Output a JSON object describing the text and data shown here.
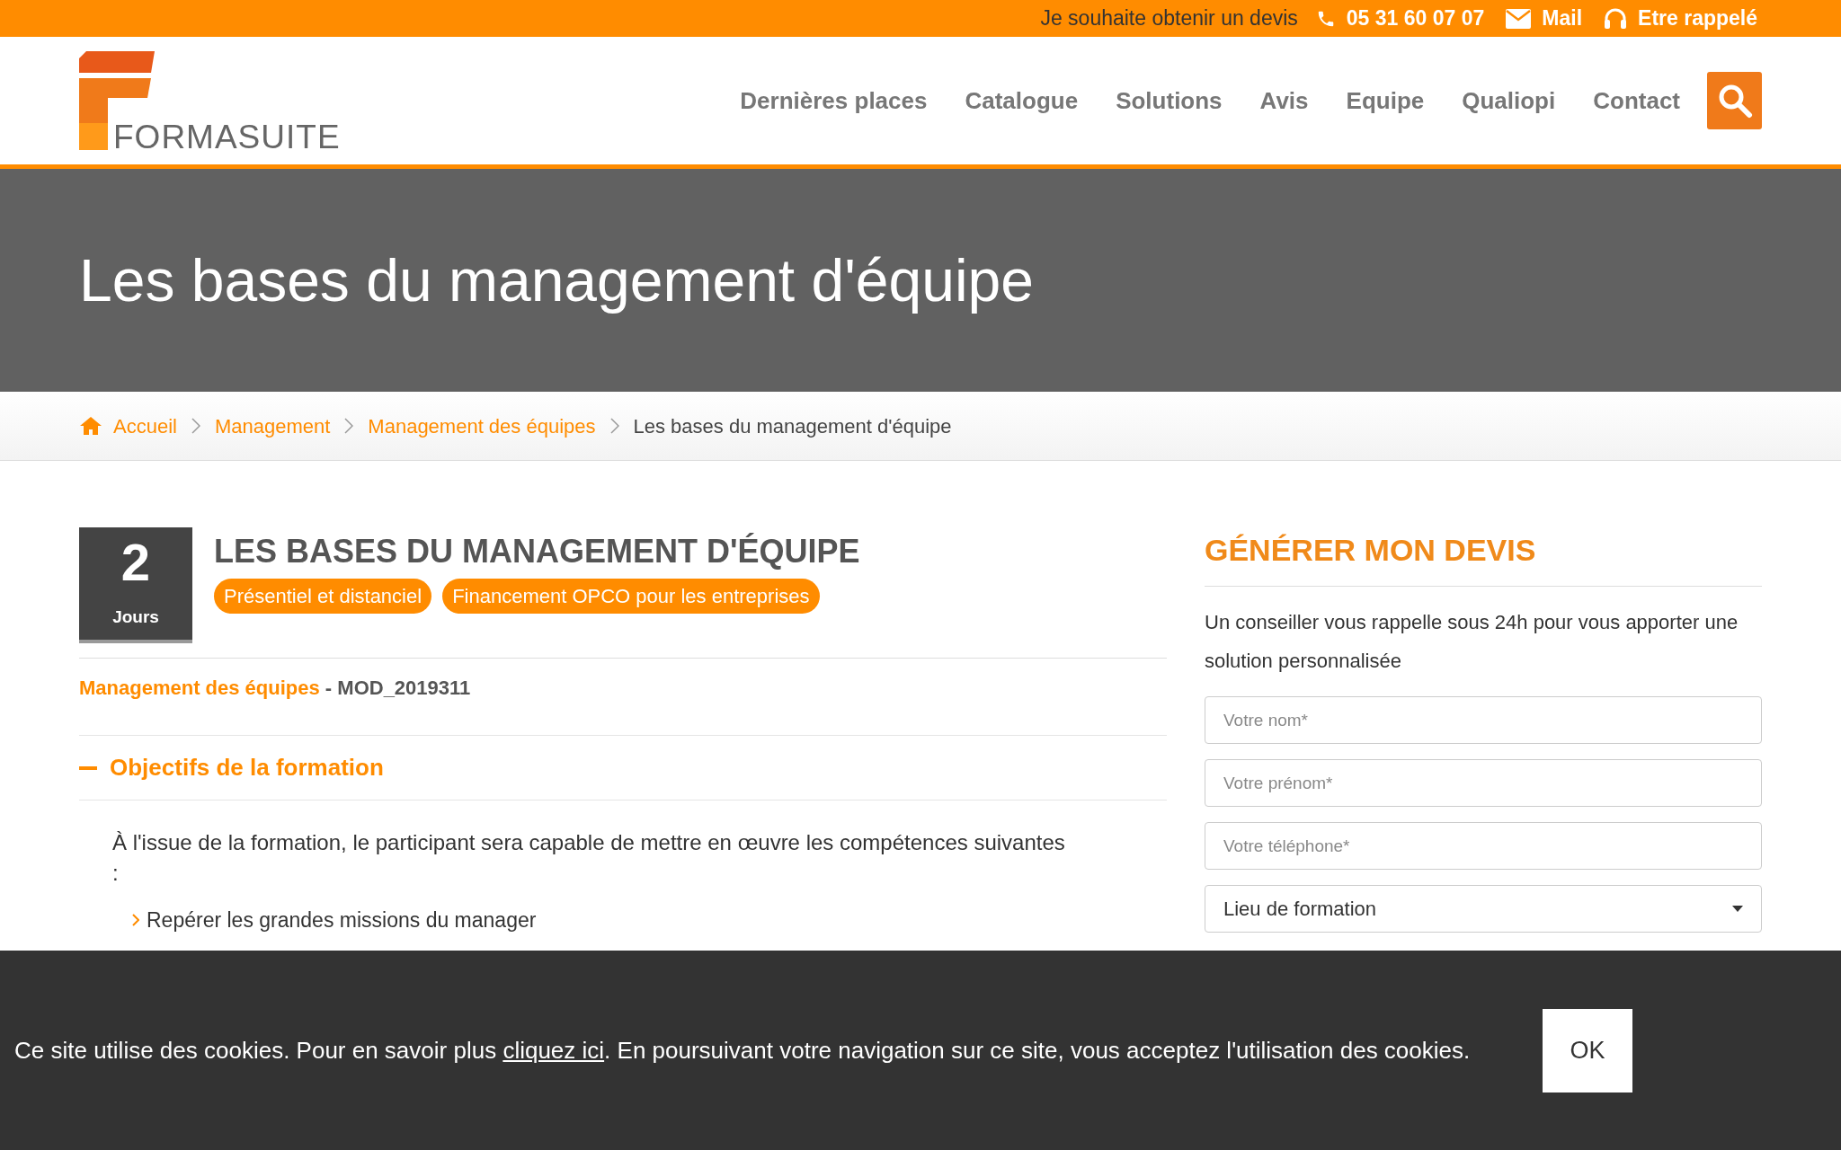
{
  "top_bar": {
    "quote_prompt": "Je souhaite obtenir un devis",
    "phone": "05 31 60 07 07",
    "mail": "Mail",
    "callback": "Etre rappelé"
  },
  "logo": {
    "text": "FORMASUITE"
  },
  "nav": {
    "items": [
      "Dernières places",
      "Catalogue",
      "Solutions",
      "Avis",
      "Equipe",
      "Qualiopi",
      "Contact"
    ]
  },
  "hero": {
    "title": "Les bases du management d'équipe"
  },
  "breadcrumb": [
    {
      "label": "Accueil",
      "current": false
    },
    {
      "label": "Management",
      "current": false
    },
    {
      "label": "Management des équipes",
      "current": false
    },
    {
      "label": "Les bases du management d'équipe",
      "current": true
    }
  ],
  "course": {
    "duration": "2",
    "duration_unit": "Jours",
    "title": "LES BASES DU MANAGEMENT D'ÉQUIPE",
    "badges": [
      "Présentiel et distanciel",
      "Financement OPCO pour les entreprises"
    ],
    "category": "Management des équipes",
    "code": " - MOD_2019311"
  },
  "section": {
    "title": "Objectifs de la formation",
    "expanded": true,
    "intro": "À l'issue de la formation, le participant sera capable de mettre en œuvre les compétences suivantes :",
    "bullets": [
      "Repérer les grandes missions du manager"
    ]
  },
  "quote_form": {
    "title": "GÉNÉRER MON DEVIS",
    "text": "Un conseiller vous rappelle sous 24h pour vous apporter une solution personnalisée",
    "fields": [
      {
        "kind": "text",
        "placeholder": "Votre nom*"
      },
      {
        "kind": "text",
        "placeholder": "Votre prénom*"
      },
      {
        "kind": "text",
        "placeholder": "Votre téléphone*"
      },
      {
        "kind": "select",
        "value": "Lieu de formation"
      }
    ]
  },
  "cookie_banner": {
    "text_before": "Ce site utilise des cookies. Pour en savoir plus ",
    "link": "cliquez ici",
    "text_after": ". En poursuivant votre navigation sur ce site, vous acceptez l'utilisation des cookies.",
    "button": "OK"
  }
}
